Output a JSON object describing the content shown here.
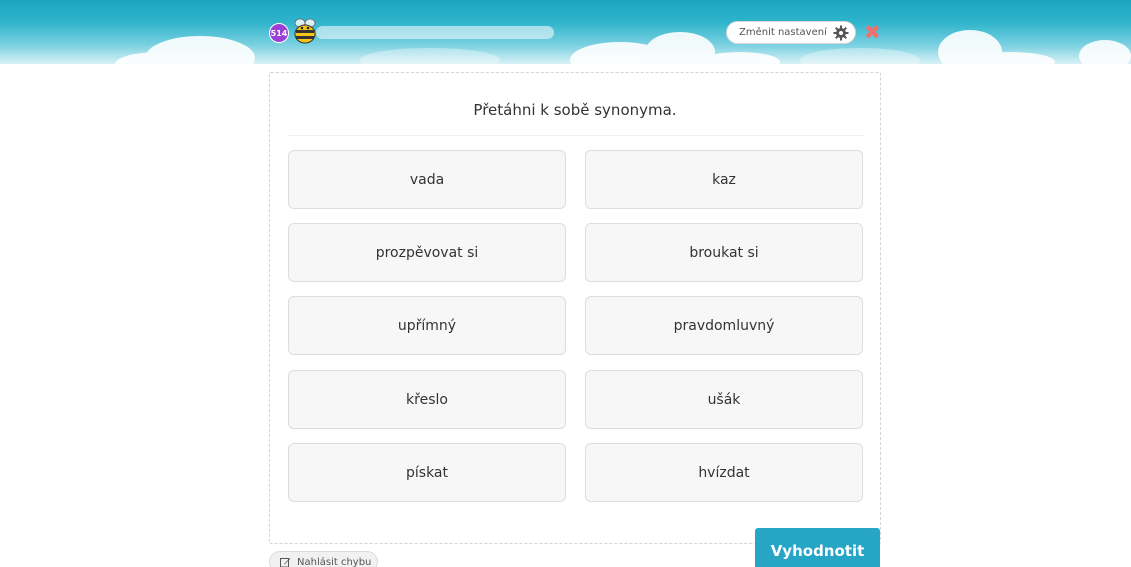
{
  "header": {
    "counter_badge": "514",
    "progress_fraction": 0.0,
    "settings_label": "Změnit nastavení",
    "close_symbol": "✖"
  },
  "exercise": {
    "instruction": "Přetáhni k sobě synonyma.",
    "left_tiles": [
      "vada",
      "prozpěvovat si",
      "upřímný",
      "křeslo",
      "pískat"
    ],
    "right_tiles": [
      "kaz",
      "broukat si",
      "pravdomluvný",
      "ušák",
      "hvízdat"
    ]
  },
  "footer": {
    "report_label": "Nahlásit chybu",
    "submit_label": "Vyhodnotit"
  },
  "colors": {
    "accent": "#26a5c4",
    "badge": "#9b3fd6",
    "close": "#f07070"
  },
  "icons": {
    "bee": "bee-mascot-icon",
    "gear": "gear-icon",
    "close": "close-icon",
    "report": "edit-icon"
  }
}
